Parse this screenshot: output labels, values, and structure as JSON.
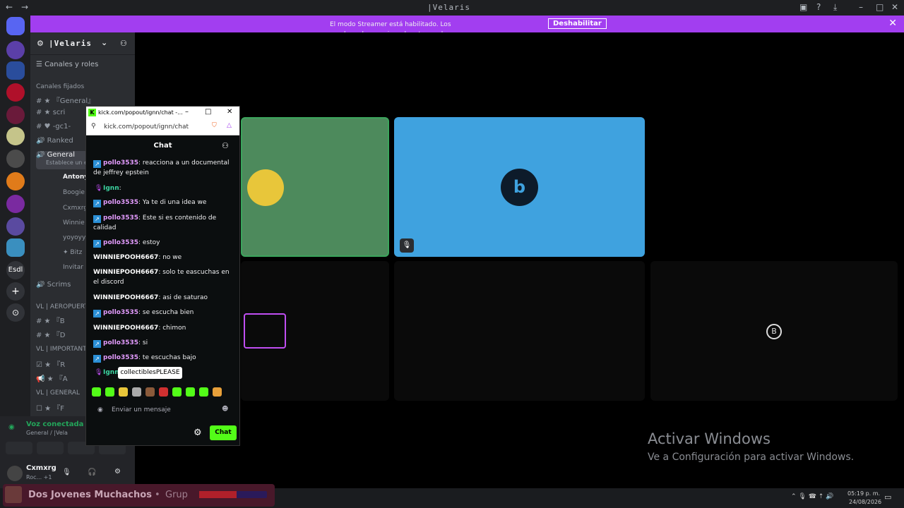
{
  "window": {
    "title": "|Velaris"
  },
  "banner": {
    "message": "El modo Streamer está habilitado. Los nombres de usuario se han truncado.",
    "button": "Deshabilitar"
  },
  "rail": {
    "last_label": "Esdl"
  },
  "server": {
    "name": "|Velaris"
  },
  "sidebar": {
    "roles_label": "Canales y roles",
    "pinned_label": "Canales fijados",
    "channels": [
      {
        "label": "『General』"
      },
      {
        "label": "scri"
      },
      {
        "label": "-gc1-"
      },
      {
        "label": "Ranked"
      },
      {
        "label": "General"
      },
      {
        "label": "Establece un es"
      }
    ],
    "voice_users": [
      "Antony",
      "Boogie",
      "Cxmxrg",
      "Winnie",
      "yoyoyy",
      "✦ Bitz",
      "Invitar a"
    ],
    "scrims": "Scrims",
    "categories": [
      "VL | AEROPUERTO",
      "VL | IMPORTANTE",
      "VL | GENERAL"
    ],
    "cat_channels_1": [
      "『B",
      "『D"
    ],
    "cat_channels_2": [
      "『R",
      "『A"
    ],
    "cat_channels_3": [
      "『F"
    ]
  },
  "voice_panel": {
    "status": "Voz conectada",
    "location": "General / |Vela",
    "user": "Cxmxrg",
    "user_status": "Roc... +1"
  },
  "popup": {
    "title": "kick.com/popout/ignn/chat -...",
    "url": "kick.com/popout/ignn/chat",
    "chat_title": "Chat",
    "messages": [
      {
        "user": "pollo3535",
        "text": ": reacciona a un documental de jeffrey epstein",
        "kind": "badge"
      },
      {
        "user": "Ignn",
        "text": ":",
        "kind": "mic"
      },
      {
        "user": "pollo3535",
        "text": ": Ya te di una idea we",
        "kind": "badge"
      },
      {
        "user": "pollo3535",
        "text": ": Este si es contenido de calidad",
        "kind": "badge"
      },
      {
        "user": "pollo3535",
        "text": ": estoy",
        "kind": "badge"
      },
      {
        "user": "WINNIEPOOH6667",
        "text": ": no we",
        "kind": "plain"
      },
      {
        "user": "WINNIEPOOH6667",
        "text": ": solo te eascuchas en el discord",
        "kind": "plain"
      },
      {
        "user": "WINNIEPOOH6667",
        "text": ": asi de saturao",
        "kind": "plain"
      },
      {
        "user": "pollo3535",
        "text": ": se escucha bien",
        "kind": "badge"
      },
      {
        "user": "WINNIEPOOH6667",
        "text": ": chimon",
        "kind": "plain"
      },
      {
        "user": "pollo3535",
        "text": ": si",
        "kind": "badge"
      },
      {
        "user": "pollo3535",
        "text": ": te escuchas bajo",
        "kind": "badge"
      },
      {
        "user": "Ignn",
        "text": "",
        "kind": "mic"
      }
    ],
    "tooltip": "collectiblesPLEASE",
    "input_placeholder": "Enviar un mensaje",
    "send_label": "Chat"
  },
  "watermark": {
    "title": "Activar Windows",
    "subtitle": "Ve a Configuración para activar Windows."
  },
  "media": {
    "title": "Dos Jovenes Muchachos",
    "artist": "Grup"
  },
  "clock": {
    "time": "05:19 p. m.",
    "date": "24/08/2026"
  },
  "colors": {
    "accent": "#a23ef0",
    "kick_green": "#53fc18",
    "tile_green": "#4d8a5c",
    "tile_blue": "#3fa2df"
  }
}
